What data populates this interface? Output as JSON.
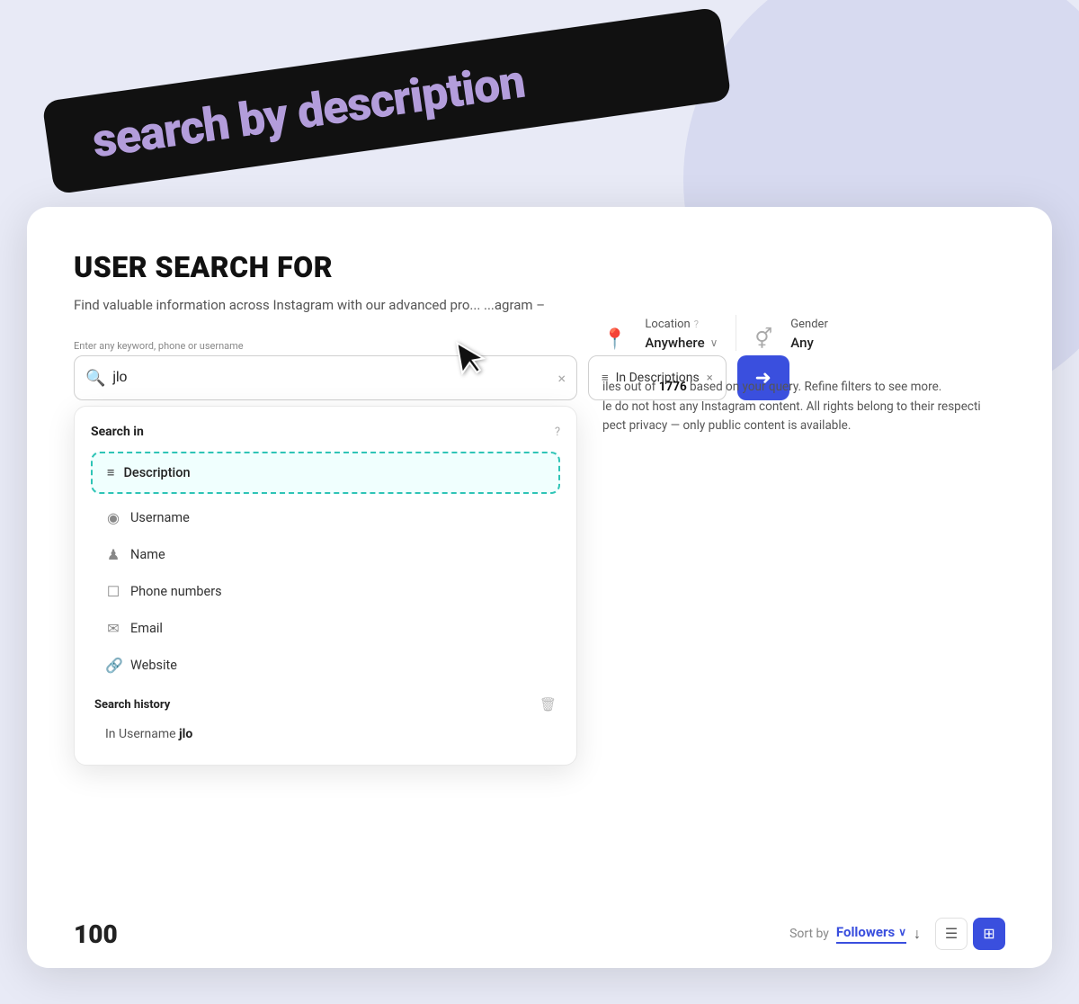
{
  "banner": {
    "text_plain": "search by ",
    "text_accent": "description"
  },
  "card": {
    "title": "USER SEARCH FOR",
    "subtitle": "Find valuable information across Instagram with our advanced pro... ...agram –",
    "search": {
      "label": "Enter any keyword, phone or username",
      "value": "jlo",
      "placeholder": "Enter any keyword, phone or username",
      "clear_label": "×"
    },
    "tag": {
      "icon": "≡",
      "label": "In Descriptions",
      "close": "×"
    },
    "search_button_icon": "→",
    "dropdown": {
      "section_label": "Search in",
      "help": "?",
      "items": [
        {
          "icon": "≡",
          "label": "Description",
          "highlighted": true
        },
        {
          "icon": "◉",
          "label": "Username"
        },
        {
          "icon": "♟",
          "label": "Name"
        },
        {
          "icon": "📱",
          "label": "Phone numbers"
        },
        {
          "icon": "✉",
          "label": "Email"
        },
        {
          "icon": "🔗",
          "label": "Website"
        }
      ],
      "history_label": "Search history",
      "history_trash_icon": "🗑",
      "history_items": [
        {
          "prefix": "In Username",
          "value": "jlo"
        }
      ]
    },
    "filters": {
      "location_icon": "📍",
      "location_label": "Location",
      "location_help": "?",
      "location_value": "Anywhere",
      "gender_icon_label": "gender-icon",
      "gender_label": "Gender",
      "gender_value": "Any"
    },
    "results": {
      "prefix": "iles out of ",
      "count": "1776",
      "suffix": " based on your query. Refine filters to see more.",
      "line2": "le do not host any Instagram content. All rights belong to their respecti",
      "line3": "pect privacy — only public content is available."
    },
    "bottom": {
      "count": "100",
      "sort_label": "Sort by",
      "sort_value": "Followers",
      "sort_chevron": "∨",
      "sort_dir": "↓",
      "view_list_icon": "☰",
      "view_grid_icon": "⊞"
    }
  }
}
